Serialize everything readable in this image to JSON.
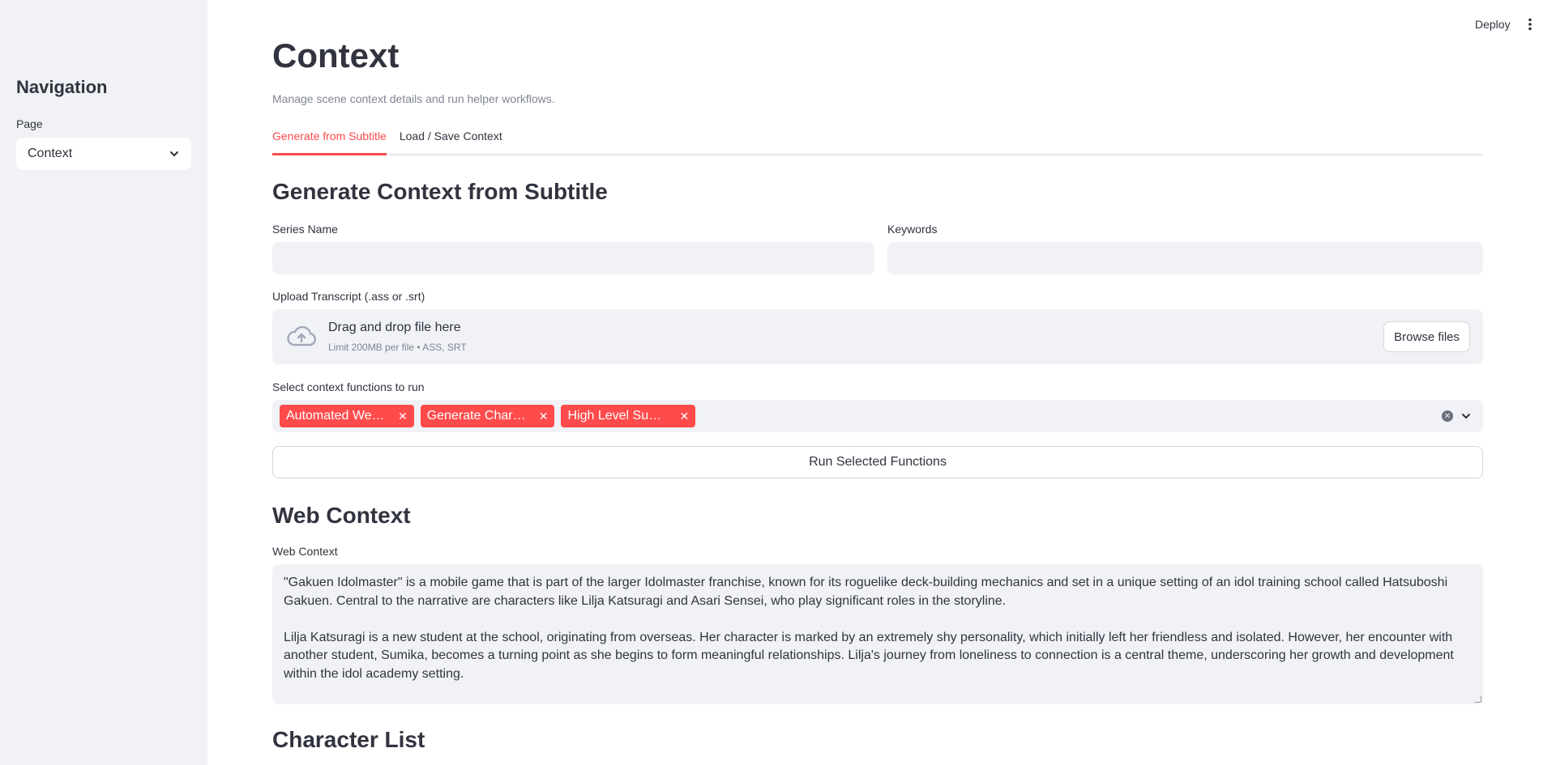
{
  "sidebar": {
    "title": "Navigation",
    "page_label": "Page",
    "page_value": "Context"
  },
  "header": {
    "deploy_label": "Deploy"
  },
  "main": {
    "title": "Context",
    "caption": "Manage scene context details and run helper workflows.",
    "tabs": [
      {
        "label": "Generate from Subtitle",
        "active": true
      },
      {
        "label": "Load / Save Context",
        "active": false
      }
    ],
    "generate_section": {
      "heading": "Generate Context from Subtitle",
      "series_name_label": "Series Name",
      "series_name_value": "",
      "keywords_label": "Keywords",
      "keywords_value": "",
      "upload_label": "Upload Transcript (.ass or .srt)",
      "dropzone_title": "Drag and drop file here",
      "dropzone_subtitle": "Limit 200MB per file • ASS, SRT",
      "browse_label": "Browse files",
      "functions_label": "Select context functions to run",
      "selected_functions": [
        "Automated Web Search",
        "Generate Character List",
        "High Level Summary"
      ],
      "run_label": "Run Selected Functions"
    },
    "web_context": {
      "heading": "Web Context",
      "label": "Web Context",
      "paragraph_1": "\"Gakuen Idolmaster\" is a mobile game that is part of the larger Idolmaster franchise, known for its roguelike deck-building mechanics and set in a unique setting of an idol training school called Hatsuboshi Gakuen. Central to the narrative are characters like Lilja Katsuragi and Asari Sensei, who play significant roles in the storyline.",
      "paragraph_2": "Lilja Katsuragi is a new student at the school, originating from overseas. Her character is marked by an extremely shy personality, which initially left her friendless and isolated. However, her encounter with another student, Sumika, becomes a turning point as she begins to form meaningful relationships. Lilja's journey from loneliness to connection is a central theme, underscoring her growth and development within the idol academy setting."
    },
    "character_list": {
      "heading": "Character List"
    }
  },
  "colors": {
    "accent": "#ff4b4b",
    "sidebar_bg": "#f0f2f6",
    "input_bg": "#f0f2f6",
    "text": "#31333f",
    "muted": "#808495"
  },
  "icons": {
    "select_chevron": "chevron-down-icon",
    "upload": "cloud-upload-icon",
    "menu": "kebab-menu-icon",
    "chip_remove": "close-icon",
    "clear_all": "clear-circle-icon"
  }
}
